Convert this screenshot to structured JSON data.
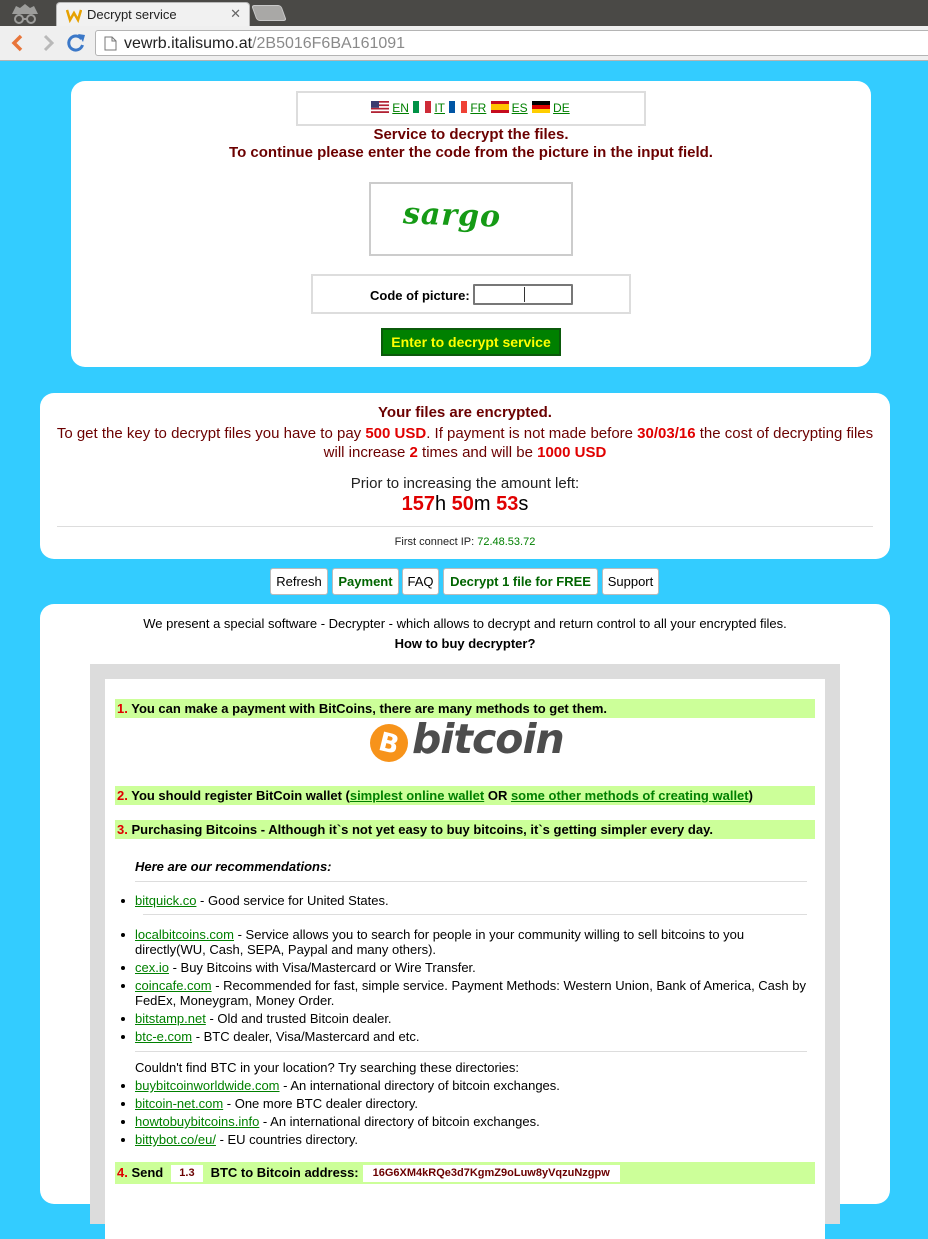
{
  "browser": {
    "tab_title": "Decrypt service",
    "tab_close": "✕",
    "url_host": "vewrb.italisumo.at",
    "url_path": "/2B5016F6BA161091"
  },
  "languages": [
    {
      "code": "EN",
      "flag": "us-flag-icon"
    },
    {
      "code": "IT",
      "flag": "italy-flag-icon"
    },
    {
      "code": "FR",
      "flag": "france-flag-icon"
    },
    {
      "code": "ES",
      "flag": "spain-flag-icon"
    },
    {
      "code": "DE",
      "flag": "germany-flag-icon"
    }
  ],
  "captcha": {
    "title_line1": "Service to decrypt the files.",
    "title_line2": "To continue please enter the code from the picture in the input field.",
    "image_text": "sargo",
    "code_label": "Code of picture:",
    "submit_label": "Enter to decrypt service"
  },
  "info": {
    "title": "Your files are encrypted.",
    "line1_a": "To get the key to decrypt files you have to pay ",
    "price": "500 USD",
    "line1_b": ". If payment is not made before ",
    "deadline": "30/03/16",
    "line1_c": " the cost of decrypting files",
    "line2_a": "will increase ",
    "multiplier": "2",
    "line2_b": " times and will be ",
    "increased_price": "1000 USD",
    "prior_label": "Prior to increasing the amount left:",
    "timer": {
      "hours": "157",
      "h": "h ",
      "minutes": "50",
      "m": "m ",
      "seconds": "53",
      "s": "s"
    },
    "ip_label": "First connect IP: ",
    "ip": "72.48.53.72"
  },
  "menu": {
    "refresh": "Refresh",
    "payment": "Payment",
    "faq": "FAQ",
    "decrypt_free": "Decrypt 1 file for FREE",
    "support": "Support"
  },
  "main": {
    "intro": "We present a special software - Decrypter - which allows to decrypt and return control to all your encrypted files.",
    "how_to": "How to buy decrypter?",
    "step1_num": "1.",
    "step1": "You can make a payment with BitCoins, there are many methods to get them.",
    "bitcoin_logo": "bitcoin",
    "step2_num": "2.",
    "step2_a": "You should register BitCoin wallet (",
    "step2_link1": "simplest online wallet",
    "step2_b": " OR ",
    "step2_link2": "some other methods of creating wallet",
    "step2_c": ")",
    "step3_num": "3.",
    "step3": "Purchasing Bitcoins - Although it`s not yet easy to buy bitcoins, it`s getting simpler every day.",
    "recommendations_title": "Here are our recommendations:",
    "exchanges": [
      {
        "link": "bitquick.co",
        "desc": " - Good service for United States."
      },
      {
        "link": "localbitcoins.com",
        "desc": " - Service allows you to search for people in your community willing to sell bitcoins to you directly(WU, Cash, SEPA, Paypal and many others)."
      },
      {
        "link": "cex.io",
        "desc": " - Buy Bitcoins with Visa/Mastercard or Wire Transfer."
      },
      {
        "link": "coincafe.com",
        "desc": " - Recommended for fast, simple service. Payment Methods: Western Union, Bank of America, Cash by FedEx, Moneygram, Money Order."
      },
      {
        "link": "bitstamp.net",
        "desc": " - Old and trusted Bitcoin dealer."
      },
      {
        "link": "btc-e.com",
        "desc": " - BTC dealer, Visa/Mastercard and etc."
      }
    ],
    "directories_note": "Couldn't find BTC in your location? Try searching these directories:",
    "directories": [
      {
        "link": "buybitcoinworldwide.com",
        "desc": " - An international directory of bitcoin exchanges."
      },
      {
        "link": "bitcoin-net.com",
        "desc": " - One more BTC dealer directory."
      },
      {
        "link": "howtobuybitcoins.info",
        "desc": " - An international directory of bitcoin exchanges."
      },
      {
        "link": "bittybot.co/eu/",
        "desc": " - EU countries directory."
      }
    ],
    "step4_num": "4.",
    "step4_a": "Send",
    "btc_amount": "1.3",
    "step4_b": "BTC to Bitcoin address:",
    "btc_address": "16G6XM4kRQe3d7KgmZ9oLuw8yVqzuNzgpw"
  },
  "colors": {
    "page_bg": "#33ccff",
    "heading": "#6b0000",
    "alert": "#e00000",
    "link": "#008000",
    "highlight": "#ccff99",
    "button_bg": "#008000",
    "button_text": "#ffff00"
  }
}
